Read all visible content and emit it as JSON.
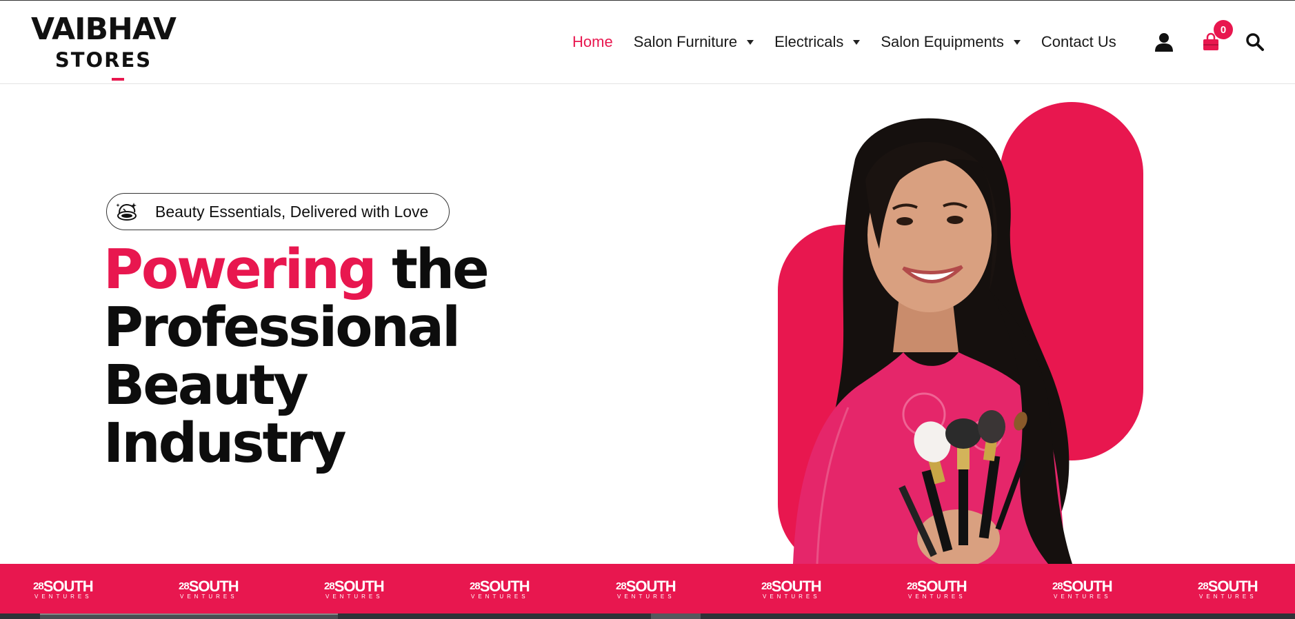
{
  "brand": {
    "name": "VAIBHAV",
    "sub": "STORES"
  },
  "nav": {
    "items": [
      {
        "label": "Home",
        "active": true,
        "dropdown": false
      },
      {
        "label": "Salon Furniture",
        "active": false,
        "dropdown": true
      },
      {
        "label": "Electricals",
        "active": false,
        "dropdown": true
      },
      {
        "label": "Salon Equipments",
        "active": false,
        "dropdown": true
      },
      {
        "label": "Contact Us",
        "active": false,
        "dropdown": false
      }
    ]
  },
  "header_icons": {
    "account": "user-icon",
    "cart": "shopping-bag-icon",
    "search": "search-icon"
  },
  "cart": {
    "count": "0"
  },
  "hero": {
    "pill_text": "Beauty Essentials, Delivered with Love",
    "pill_icon": "compact-mirror-icon",
    "headline_accent": "Powering",
    "headline_rest_1": "the",
    "headline_line_2": "Professional Beauty",
    "headline_line_3": "Industry"
  },
  "marquee": {
    "logo_main": "28",
    "logo_word": "SOUTH",
    "logo_sub": "VENTURES",
    "count": 9
  },
  "colors": {
    "accent": "#e8174f",
    "text": "#0d0d0d",
    "strip": "#2f3237"
  }
}
